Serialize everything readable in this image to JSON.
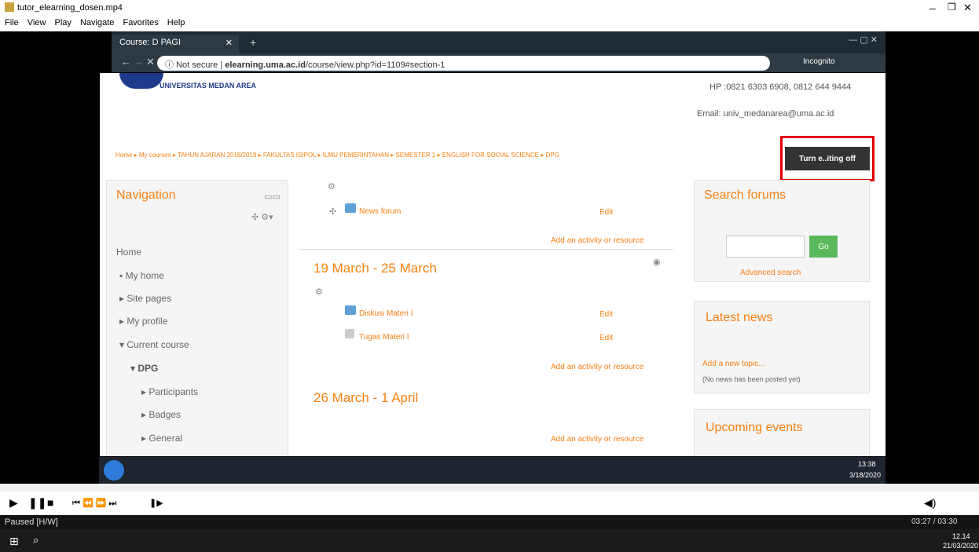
{
  "window": {
    "title": "tutor_elearning_dosen.mp4",
    "menu": [
      "File",
      "View",
      "Play",
      "Navigate",
      "Favorites",
      "Help"
    ]
  },
  "browser": {
    "tab_title": "Course: D PAGI",
    "url_prefix": "Not secure",
    "url_host": "elearning.uma.ac.id",
    "url_path": "/course/view.php?id=1109#section-1",
    "incognito": "Incognito"
  },
  "site": {
    "logo_text": "UNIVERSITAS MEDAN AREA",
    "phone": "HP :0821 6303 6908, 0812 644 9444",
    "email": "Email: univ_medanarea@uma.ac.id"
  },
  "breadcrumb": [
    "Home",
    "My courses",
    "TAHUN AJARAN 2018/2019",
    "FAKULTAS ISIPOL",
    "ILMU PEMERINTAHAN",
    "SEMESTER 1",
    "ENGLISH FOR SOCIAL SCIENCE",
    "DPG"
  ],
  "editing_button": "Turn e..iting off",
  "navigation": {
    "title": "Navigation",
    "items": [
      "Home",
      "My home",
      "Site pages",
      "My profile",
      "Current course",
      "DPG",
      "Participants",
      "Badges",
      "General"
    ]
  },
  "course": {
    "section0_item": "News forum",
    "edit": "Edit",
    "add_activity": "Add an activity or resource",
    "section1_title": "19 March - 25 March",
    "section1_items": [
      "Diskusi Materi I",
      "Tugas Materi I"
    ],
    "section2_title": "26 March - 1 April"
  },
  "search_forums": {
    "title": "Search forums",
    "go": "Go",
    "advanced": "Advanced search"
  },
  "latest_news": {
    "title": "Latest news",
    "add": "Add a new topic...",
    "none": "(No news has been posted yet)"
  },
  "upcoming": {
    "title": "Upcoming events"
  },
  "inner_clock": {
    "time": "13:38",
    "date": "3/18/2020"
  },
  "player": {
    "status": "Paused [H/W]",
    "time": "03:27 / 03:30"
  },
  "clock": {
    "time": "12.14",
    "date": "21/03/2020"
  }
}
